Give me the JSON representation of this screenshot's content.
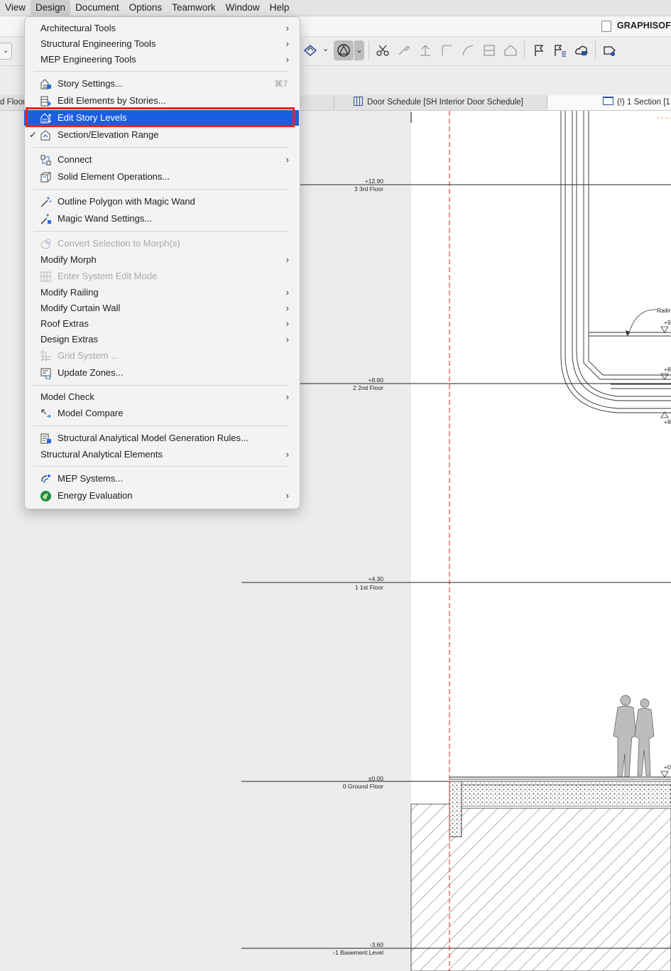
{
  "menubar": [
    "View",
    "Design",
    "Document",
    "Options",
    "Teamwork",
    "Window",
    "Help"
  ],
  "brand": "GRAPHISOF",
  "tabs": {
    "left": "d Floor",
    "door_schedule": "Door Schedule [SH Interior Door Schedule]",
    "section": "(!) 1 Section [1"
  },
  "menu": {
    "items": [
      {
        "label": "Architectural Tools",
        "submenu": true
      },
      {
        "label": "Structural Engineering Tools",
        "submenu": true
      },
      {
        "label": "MEP Engineering Tools",
        "submenu": true
      },
      {
        "label": "Story Settings...",
        "shortcut": "⌘7",
        "icon": "story-settings-icon"
      },
      {
        "label": "Edit Elements by Stories...",
        "icon": "edit-by-stories-icon"
      },
      {
        "label": "Edit Story Levels",
        "icon": "story-levels-icon",
        "highlighted": true
      },
      {
        "label": "Section/Elevation Range",
        "icon": "section-range-icon",
        "checked": "✓"
      },
      {
        "label": "Connect",
        "icon": "connect-icon",
        "submenu": true
      },
      {
        "label": "Solid Element Operations...",
        "icon": "solid-ops-icon"
      },
      {
        "label": "Outline Polygon with Magic Wand",
        "icon": "magic-wand-icon"
      },
      {
        "label": "Magic Wand Settings...",
        "icon": "magic-wand-settings-icon"
      },
      {
        "label": "Convert Selection to Morph(s)",
        "icon": "morph-convert-icon",
        "disabled": true
      },
      {
        "label": "Modify Morph",
        "submenu": true
      },
      {
        "label": "Enter System Edit Mode",
        "icon": "system-edit-icon",
        "disabled": true
      },
      {
        "label": "Modify Railing",
        "submenu": true
      },
      {
        "label": "Modify Curtain Wall",
        "submenu": true
      },
      {
        "label": "Roof Extras",
        "submenu": true
      },
      {
        "label": "Design Extras",
        "submenu": true
      },
      {
        "label": "Grid System ...",
        "icon": "grid-system-icon",
        "disabled": true
      },
      {
        "label": "Update Zones...",
        "icon": "update-zones-icon"
      },
      {
        "label": "Model Check",
        "submenu": true
      },
      {
        "label": "Model Compare",
        "icon": "model-compare-icon"
      },
      {
        "label": "Structural Analytical Model Generation Rules...",
        "icon": "analytical-rules-icon"
      },
      {
        "label": "Structural Analytical Elements",
        "submenu": true
      },
      {
        "label": "MEP Systems...",
        "icon": "mep-systems-icon"
      },
      {
        "label": "Energy Evaluation",
        "icon": "energy-evaluation-icon",
        "submenu": true
      }
    ]
  },
  "levels": [
    {
      "elev": "+12.90",
      "name": "3 3rd Floor"
    },
    {
      "elev": "+8.60",
      "name": "2 2nd Floor"
    },
    {
      "elev": "+4.30",
      "name": "1 1st Floor"
    },
    {
      "elev": "±0.00",
      "name": "0 Ground Floor"
    },
    {
      "elev": "-3.60",
      "name": "-1 Basement Level"
    }
  ],
  "annotations": {
    "railing": "Railin",
    "mark_9": "+9",
    "mark_8a": "+8",
    "mark_8b": "+8",
    "mark_0": "+0"
  }
}
